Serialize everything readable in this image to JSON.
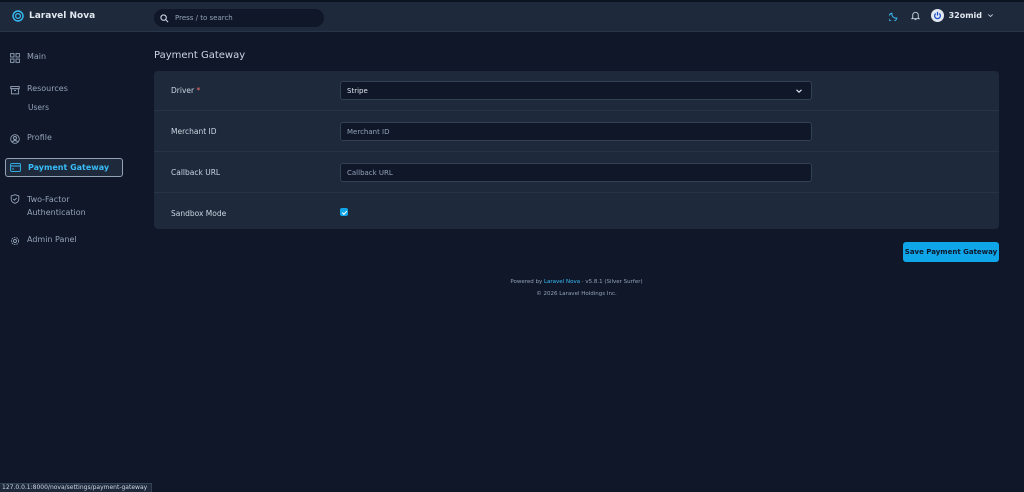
{
  "app": {
    "title": "Laravel Nova"
  },
  "search": {
    "placeholder": "Press / to search"
  },
  "user": {
    "name": "32omid"
  },
  "sidebar": {
    "items": [
      {
        "label": "Main",
        "icon": "grid-icon"
      },
      {
        "label": "Resources",
        "icon": "archive-icon",
        "children": [
          "Users"
        ]
      },
      {
        "label": "Profile",
        "icon": "user-circle-icon"
      },
      {
        "label": "Payment Gateway",
        "icon": "credit-card-icon",
        "active": true
      },
      {
        "label": "Two-Factor",
        "label2": "Authentication",
        "icon": "shield-check-icon"
      },
      {
        "label": "Admin Panel",
        "icon": "cog-icon"
      }
    ]
  },
  "page": {
    "title": "Payment Gateway"
  },
  "form": {
    "driver": {
      "label": "Driver",
      "required_mark": "*",
      "value": "Stripe"
    },
    "merchant_id": {
      "label": "Merchant ID",
      "placeholder": "Merchant ID"
    },
    "callback_url": {
      "label": "Callback URL",
      "placeholder": "Callback URL"
    },
    "sandbox_mode": {
      "label": "Sandbox Mode",
      "checked": true
    },
    "save_label": "Save Payment Gateway"
  },
  "footer": {
    "powered_prefix": "Powered by",
    "brand": "Laravel Nova",
    "version": "· v5.8.1 (Silver Surfer)",
    "copyright": "© 2026 Laravel Holdings Inc."
  },
  "status_bar": {
    "url": "127.0.0.1:8000/nova/settings/payment-gateway"
  },
  "colors": {
    "accent": "#0ea5e9",
    "background": "#0f1729",
    "panel": "#1e293b"
  }
}
